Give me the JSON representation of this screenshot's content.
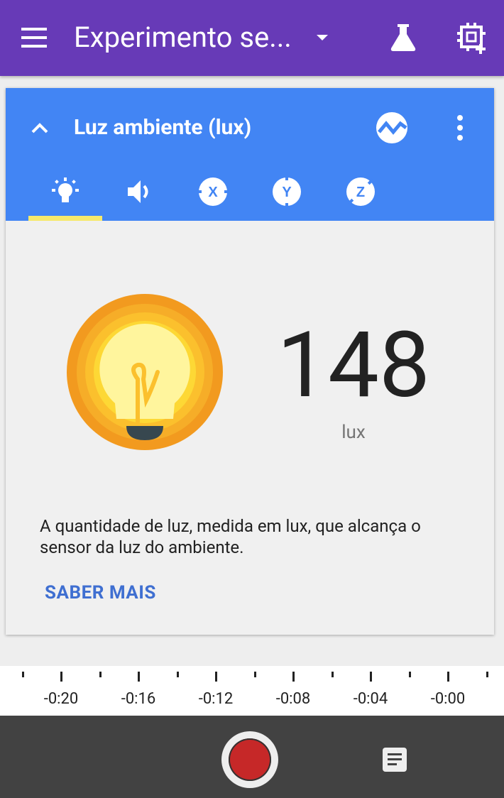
{
  "appbar": {
    "title": "Experimento se...",
    "color": "#673ab7",
    "icons": [
      "menu-icon",
      "chevron-down-icon",
      "flask-icon",
      "add-sensor-icon"
    ]
  },
  "sensor_card": {
    "title": "Luz ambiente (lux)",
    "header_color": "#4285f4",
    "tabs": [
      {
        "name": "light",
        "icon": "lightbulb-icon",
        "selected": true
      },
      {
        "name": "sound",
        "icon": "speaker-icon",
        "selected": false
      },
      {
        "name": "accel-x",
        "label": "X",
        "selected": false
      },
      {
        "name": "accel-y",
        "label": "Y",
        "selected": false
      },
      {
        "name": "accel-z",
        "label": "Z",
        "selected": false
      }
    ],
    "reading": {
      "value": "148",
      "unit": "lux"
    },
    "description": "A quantidade de luz, medida em lux, que alcança o sensor da luz do ambiente.",
    "learn_more": "SABER MAIS"
  },
  "timeline": {
    "labels": [
      "-0:20",
      "-0:16",
      "-0:12",
      "-0:08",
      "-0:04",
      "-0:00"
    ]
  },
  "bottom_bar": {
    "record_color": "#c62828",
    "icons": [
      "record-button",
      "notes-icon"
    ]
  }
}
